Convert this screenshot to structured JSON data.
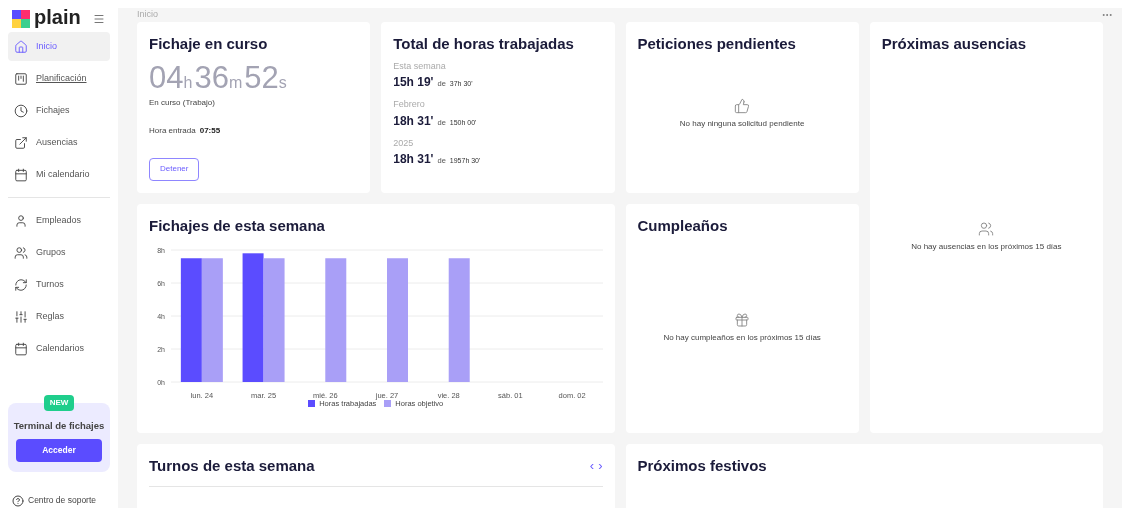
{
  "brand": {
    "name": "plain"
  },
  "sidebar": {
    "groups": [
      [
        {
          "label": "Inicio",
          "selected": true,
          "hovered": false
        },
        {
          "label": "Planificación",
          "selected": false,
          "hovered": true
        },
        {
          "label": "Fichajes",
          "selected": false,
          "hovered": false
        },
        {
          "label": "Ausencias",
          "selected": false,
          "hovered": false
        },
        {
          "label": "Mi calendario",
          "selected": false,
          "hovered": false
        }
      ],
      [
        {
          "label": "Empleados",
          "selected": false,
          "hovered": false
        },
        {
          "label": "Grupos",
          "selected": false,
          "hovered": false
        },
        {
          "label": "Turnos",
          "selected": false,
          "hovered": false
        },
        {
          "label": "Reglas",
          "selected": false,
          "hovered": false
        },
        {
          "label": "Calendarios",
          "selected": false,
          "hovered": false
        }
      ]
    ],
    "promo": {
      "badge": "NEW",
      "title": "Terminal de fichajes",
      "button": "Acceder"
    },
    "support": "Centro de soporte"
  },
  "breadcrumb": "Inicio",
  "current_clock": {
    "title": "Fichaje en curso",
    "timer": [
      {
        "value": "04",
        "unit": "h"
      },
      {
        "value": "36",
        "unit": "m"
      },
      {
        "value": "52",
        "unit": "s"
      }
    ],
    "status": "En curso (Trabajo)",
    "entry_label": "Hora entrada",
    "entry_time": "07:55",
    "button": "Detener"
  },
  "total_hours": {
    "title": "Total de horas trabajadas",
    "periods": [
      {
        "label": "Esta semana",
        "value": "15h 19'",
        "of": "de",
        "target": "37h 30'"
      },
      {
        "label": "Febrero",
        "value": "18h 31'",
        "of": "de",
        "target": "150h 00'"
      },
      {
        "label": "2025",
        "value": "18h 31'",
        "of": "de",
        "target": "1957h 30'"
      }
    ]
  },
  "pending_requests": {
    "title": "Peticiones pendientes",
    "empty": "No hay ninguna solicitud pendiente"
  },
  "upcoming_absences": {
    "title": "Próximas ausencias",
    "empty": "No hay ausencias en los próximos 15 días"
  },
  "week_clockings": {
    "title": "Fichajes de esta semana",
    "chart_data": {
      "type": "bar",
      "categories": [
        "lun. 24",
        "mar. 25",
        "mié. 26",
        "jue. 27",
        "vie. 28",
        "sáb. 01",
        "dom. 02"
      ],
      "ylim": [
        0,
        8
      ],
      "grid": true,
      "legend": true,
      "yticks": [
        {
          "value": 0,
          "label": "0h"
        },
        {
          "value": 2,
          "label": "2h"
        },
        {
          "value": 4,
          "label": "4h"
        },
        {
          "value": 6,
          "label": "6h"
        },
        {
          "value": 8,
          "label": "8h"
        }
      ],
      "series": [
        {
          "name": "Horas trabajadas",
          "color": "#5b4cff",
          "values": [
            7.5,
            7.8,
            null,
            null,
            null,
            null,
            null
          ]
        },
        {
          "name": "Horas objetivo",
          "color": "#a99ff7",
          "values": [
            7.5,
            7.5,
            7.5,
            7.5,
            7.5,
            null,
            null
          ]
        }
      ]
    }
  },
  "birthdays": {
    "title": "Cumpleaños",
    "empty": "No hay cumpleaños en los próximos 15 días"
  },
  "week_shifts": {
    "title": "Turnos de esta semana",
    "prev": "‹",
    "next": "›"
  },
  "holidays": {
    "title": "Próximos festivos"
  }
}
